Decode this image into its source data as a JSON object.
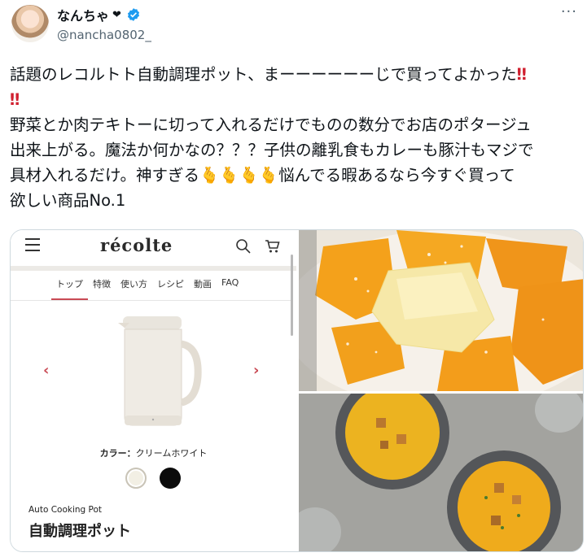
{
  "author": {
    "display_name": "なんちゃ",
    "heart": "❤",
    "handle": "@nancha0802_"
  },
  "icons": {
    "verified": "verified-badge-icon",
    "more": "more-dots-icon",
    "menu": "hamburger-menu-icon",
    "search": "search-icon",
    "cart": "cart-icon"
  },
  "tweet": {
    "line1": "話題のレコルトト自動調理ポット、まーーーーーーじで買ってよかった",
    "bang1": "‼",
    "bang2": "‼",
    "line3": "野菜とか肉テキトーに切って入れるだけでものの数分でお店のポタージュ",
    "line4": "出来上がる。魔法か何かなの？？？子供の離乳食もカレーも豚汁もマジで",
    "line5a": "具材入れるだけ。神すぎる",
    "emoji": "🫰🫰🫰🫰",
    "line5b": "悩んでる暇あるなら今すぐ買って",
    "line6": "欲しい商品No.1"
  },
  "site": {
    "logo": "récolte",
    "nav": [
      "トップ",
      "特徴",
      "使い方",
      "レシピ",
      "動画",
      "FAQ"
    ],
    "prev_arrow": "‹",
    "next_arrow": "›",
    "color_label_key": "カラー：",
    "color_label_value": "クリームホワイト",
    "product_en": "Auto Cooking Pot",
    "product_jp": "自動調理ポット"
  },
  "colors": {
    "accent": "#c94a55",
    "verified": "#1d9bf0",
    "pumpkin": "#f2a020",
    "soup": "#f0a71c"
  }
}
